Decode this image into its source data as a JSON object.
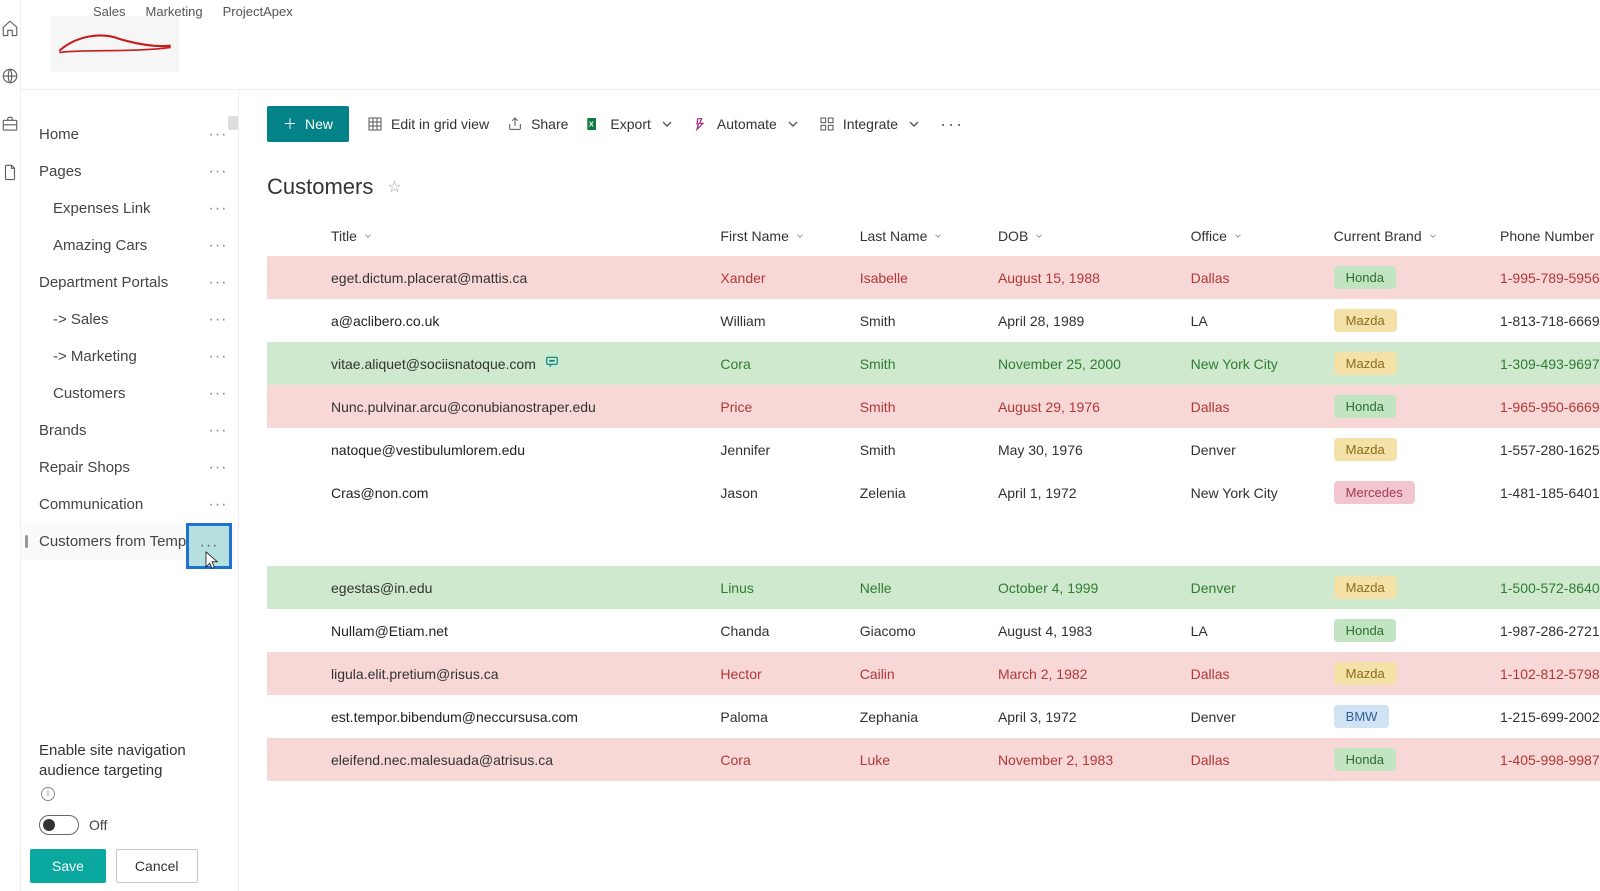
{
  "top_tabs": [
    "Sales",
    "Marketing",
    "ProjectApex"
  ],
  "nav": {
    "items": [
      {
        "label": "Home",
        "indent": 0
      },
      {
        "label": "Pages",
        "indent": 0
      },
      {
        "label": "Expenses Link",
        "indent": 1
      },
      {
        "label": "Amazing Cars",
        "indent": 1
      },
      {
        "label": "Department Portals",
        "indent": 0
      },
      {
        "label": "-> Sales",
        "indent": 1
      },
      {
        "label": "-> Marketing",
        "indent": 1
      },
      {
        "label": "Customers",
        "indent": 1
      },
      {
        "label": "Brands",
        "indent": 0
      },
      {
        "label": "Repair Shops",
        "indent": 0
      },
      {
        "label": "Communication",
        "indent": 0
      },
      {
        "label": "Customers from Template",
        "indent": 0,
        "selected": true,
        "highlighted": true
      }
    ],
    "audience_label": "Enable site navigation audience targeting",
    "toggle_text": "Off",
    "save_label": "Save",
    "cancel_label": "Cancel"
  },
  "cmdbar": {
    "new": "New",
    "edit_grid": "Edit in grid view",
    "share": "Share",
    "export": "Export",
    "automate": "Automate",
    "integrate": "Integrate"
  },
  "page_title": "Customers",
  "table": {
    "columns": [
      "",
      "Title",
      "First Name",
      "Last Name",
      "DOB",
      "Office",
      "Current Brand",
      "Phone Number"
    ],
    "rows": [
      {
        "color": "red",
        "title": "eget.dictum.placerat@mattis.ca",
        "first": "Xander",
        "last": "Isabelle",
        "dob": "August 15, 1988",
        "office": "Dallas",
        "brand": "Honda",
        "phone": "1-995-789-5956"
      },
      {
        "color": "white",
        "title": "a@aclibero.co.uk",
        "first": "William",
        "last": "Smith",
        "dob": "April 28, 1989",
        "office": "LA",
        "brand": "Mazda",
        "phone": "1-813-718-6669"
      },
      {
        "color": "green",
        "title": "vitae.aliquet@sociisnatoque.com",
        "comment": true,
        "first": "Cora",
        "last": "Smith",
        "dob": "November 25, 2000",
        "office": "New York City",
        "brand": "Mazda",
        "phone": "1-309-493-9697"
      },
      {
        "color": "red",
        "title": "Nunc.pulvinar.arcu@conubianostraper.edu",
        "first": "Price",
        "last": "Smith",
        "dob": "August 29, 1976",
        "office": "Dallas",
        "brand": "Honda",
        "phone": "1-965-950-6669"
      },
      {
        "color": "white",
        "title": "natoque@vestibulumlorem.edu",
        "first": "Jennifer",
        "last": "Smith",
        "dob": "May 30, 1976",
        "office": "Denver",
        "brand": "Mazda",
        "phone": "1-557-280-1625"
      },
      {
        "color": "white",
        "title": "Cras@non.com",
        "first": "Jason",
        "last": "Zelenia",
        "dob": "April 1, 1972",
        "office": "New York City",
        "brand": "Mercedes",
        "phone": "1-481-185-6401"
      },
      {
        "gap": true
      },
      {
        "color": "green",
        "title": "egestas@in.edu",
        "first": "Linus",
        "last": "Nelle",
        "dob": "October 4, 1999",
        "office": "Denver",
        "brand": "Mazda",
        "phone": "1-500-572-8640"
      },
      {
        "color": "white",
        "title": "Nullam@Etiam.net",
        "first": "Chanda",
        "last": "Giacomo",
        "dob": "August 4, 1983",
        "office": "LA",
        "brand": "Honda",
        "phone": "1-987-286-2721"
      },
      {
        "color": "red",
        "title": "ligula.elit.pretium@risus.ca",
        "first": "Hector",
        "last": "Cailin",
        "dob": "March 2, 1982",
        "office": "Dallas",
        "brand": "Mazda",
        "phone": "1-102-812-5798"
      },
      {
        "color": "white",
        "title": "est.tempor.bibendum@neccursusa.com",
        "first": "Paloma",
        "last": "Zephania",
        "dob": "April 3, 1972",
        "office": "Denver",
        "brand": "BMW",
        "phone": "1-215-699-2002"
      },
      {
        "color": "red",
        "title": "eleifend.nec.malesuada@atrisus.ca",
        "first": "Cora",
        "last": "Luke",
        "dob": "November 2, 1983",
        "office": "Dallas",
        "brand": "Honda",
        "phone": "1-405-998-9987"
      }
    ]
  },
  "brand_pill": {
    "Honda": "pill-honda",
    "Mazda": "pill-mazda",
    "Mercedes": "pill-mercedes",
    "BMW": "pill-bmw"
  }
}
